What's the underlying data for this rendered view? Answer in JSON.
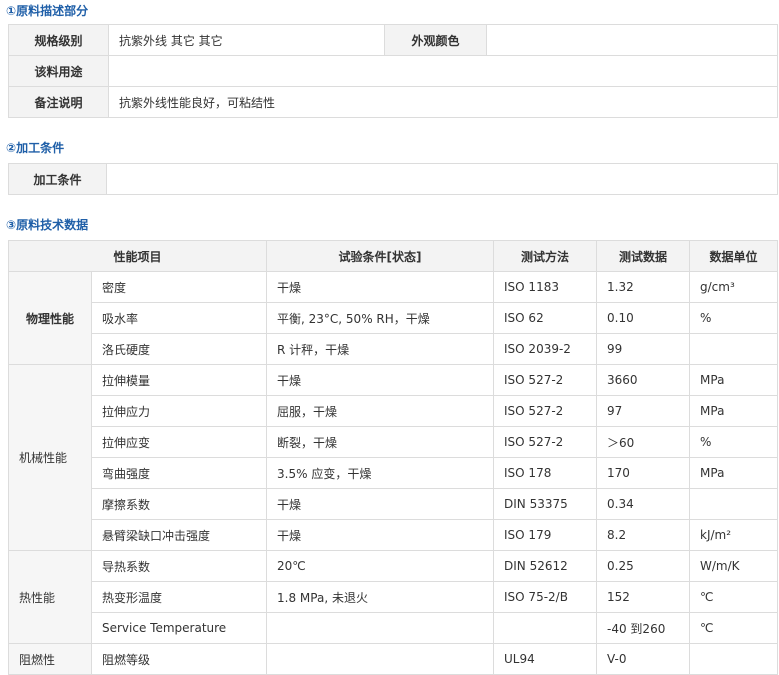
{
  "sec1": {
    "title": "①原料描述部分",
    "spec_label": "规格级别",
    "spec_value": "抗紫外线 其它 其它",
    "color_label": "外观颜色",
    "color_value": "",
    "use_label": "该料用途",
    "use_value": "",
    "note_label": "备注说明",
    "note_value": "抗紫外线性能良好，可粘结性"
  },
  "sec2": {
    "title": "②加工条件",
    "label": "加工条件",
    "value": ""
  },
  "sec3": {
    "title": "③原料技术数据",
    "headers": [
      "性能项目",
      "试验条件[状态]",
      "测试方法",
      "测试数据",
      "数据单位"
    ],
    "groups": [
      {
        "name": "物理性能",
        "rows": [
          {
            "prop": "密度",
            "cond": "干燥",
            "method": "ISO 1183",
            "value": "1.32",
            "unit": "g/cm³"
          },
          {
            "prop": "吸水率",
            "cond": "平衡, 23°C, 50% RH，干燥",
            "method": "ISO 62",
            "value": "0.10",
            "unit": "%"
          },
          {
            "prop": "洛氏硬度",
            "cond": "R 计秤，干燥",
            "method": "ISO 2039-2",
            "value": "99",
            "unit": ""
          }
        ]
      },
      {
        "name": "机械性能",
        "rows": [
          {
            "prop": "拉伸模量",
            "cond": "干燥",
            "method": "ISO 527-2",
            "value": "3660",
            "unit": "MPa"
          },
          {
            "prop": "拉伸应力",
            "cond": "屈服，干燥",
            "method": "ISO 527-2",
            "value": "97",
            "unit": "MPa"
          },
          {
            "prop": "拉伸应变",
            "cond": "断裂，干燥",
            "method": "ISO 527-2",
            "value": "＞60",
            "unit": "%"
          },
          {
            "prop": "弯曲强度",
            "cond": "3.5% 应变，干燥",
            "method": "ISO 178",
            "value": "170",
            "unit": "MPa"
          },
          {
            "prop": "摩擦系数",
            "cond": "干燥",
            "method": "DIN 53375",
            "value": "0.34",
            "unit": ""
          },
          {
            "prop": "悬臂梁缺口冲击强度",
            "cond": "干燥",
            "method": "ISO 179",
            "value": "8.2",
            "unit": "kJ/m²"
          }
        ]
      },
      {
        "name": "热性能",
        "rows": [
          {
            "prop": "导热系数",
            "cond": "20℃",
            "method": "DIN 52612",
            "value": "0.25",
            "unit": "W/m/K"
          },
          {
            "prop": "热变形温度",
            "cond": "1.8 MPa, 未退火",
            "method": "ISO 75-2/B",
            "value": "152",
            "unit": "℃"
          },
          {
            "prop": "Service Temperature",
            "cond": "",
            "method": "",
            "value": "-40 到260",
            "unit": "℃"
          }
        ]
      },
      {
        "name": "阻燃性",
        "rows": [
          {
            "prop": "阻燃等级",
            "cond": "",
            "method": "UL94",
            "value": "V-0",
            "unit": ""
          }
        ]
      }
    ]
  }
}
